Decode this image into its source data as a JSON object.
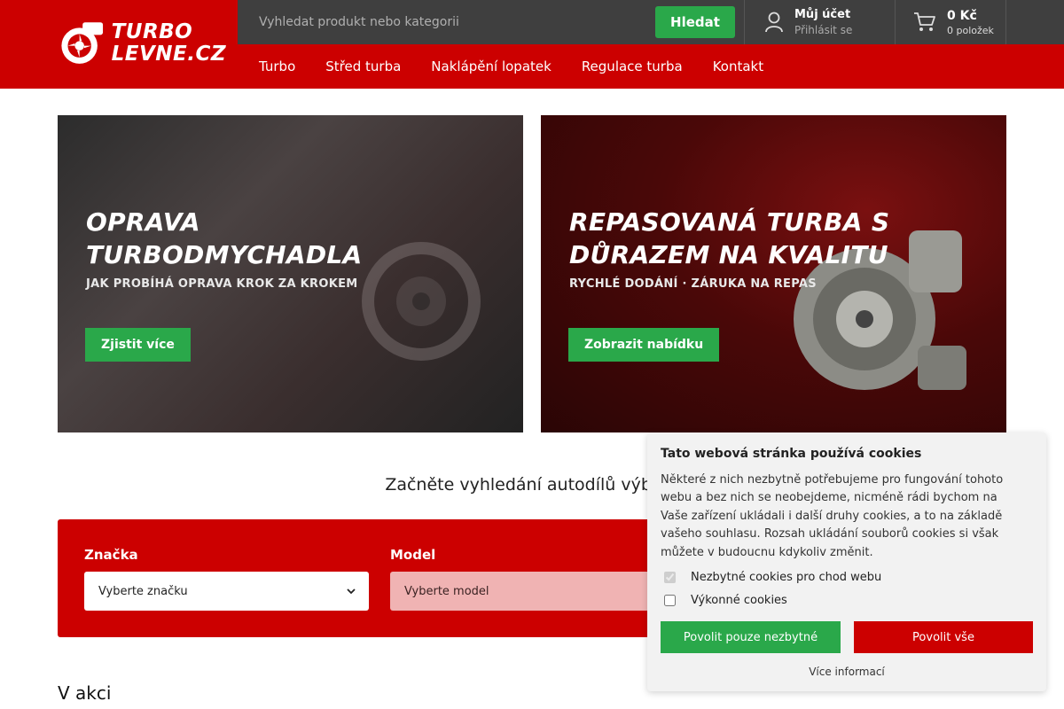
{
  "logo": {
    "line1": "TURBO",
    "line2": "LEVNE.CZ"
  },
  "search": {
    "placeholder": "Vyhledat produkt nebo kategorii",
    "button": "Hledat"
  },
  "account": {
    "title": "Můj účet",
    "subtitle": "Přihlásit se"
  },
  "cart": {
    "price": "0 Kč",
    "count": "0 položek"
  },
  "nav": [
    "Turbo",
    "Střed turba",
    "Naklápění lopatek",
    "Regulace turba",
    "Kontakt"
  ],
  "banners": [
    {
      "title_line1": "OPRAVA",
      "title_line2": "TURBODMYCHADLA",
      "subtitle": "JAK PROBÍHÁ OPRAVA KROK ZA KROKEM",
      "button": "Zjistit více"
    },
    {
      "title_line1": "REPASOVANÁ TURBA S",
      "title_line2": "DŮRAZEM NA KVALITU",
      "subtitle": "RYCHLÉ DODÁNÍ · ZÁRUKA NA REPAS",
      "button": "Zobrazit nabídku"
    }
  ],
  "finder": {
    "heading": "Začněte vyhledání autodílů výběre",
    "brand_label": "Značka",
    "brand_value": "Vyberte značku",
    "model_label": "Model",
    "model_value": "Vyberte model"
  },
  "sale_heading": "V akci",
  "cookies": {
    "title": "Tato webová stránka používá cookies",
    "text": "Některé z nich nezbytně potřebujeme pro fungování tohoto webu a bez nich se neobejdeme, nicméně rádi bychom na Vaše zařízení ukládali i další druhy cookies, a to na základě vašeho souhlasu. Rozsah ukládání souborů cookies si však můžete v budoucnu kdykoliv změnit.",
    "option_necessary": "Nezbytné cookies pro chod webu",
    "option_performance": "Výkonné cookies",
    "btn_necessary": "Povolit pouze nezbytné",
    "btn_all": "Povolit vše",
    "more": "Více informací"
  },
  "colors": {
    "brand_red": "#cc0000",
    "accent_green": "#2aa84a",
    "topbar_dark": "#3f3f3f"
  }
}
